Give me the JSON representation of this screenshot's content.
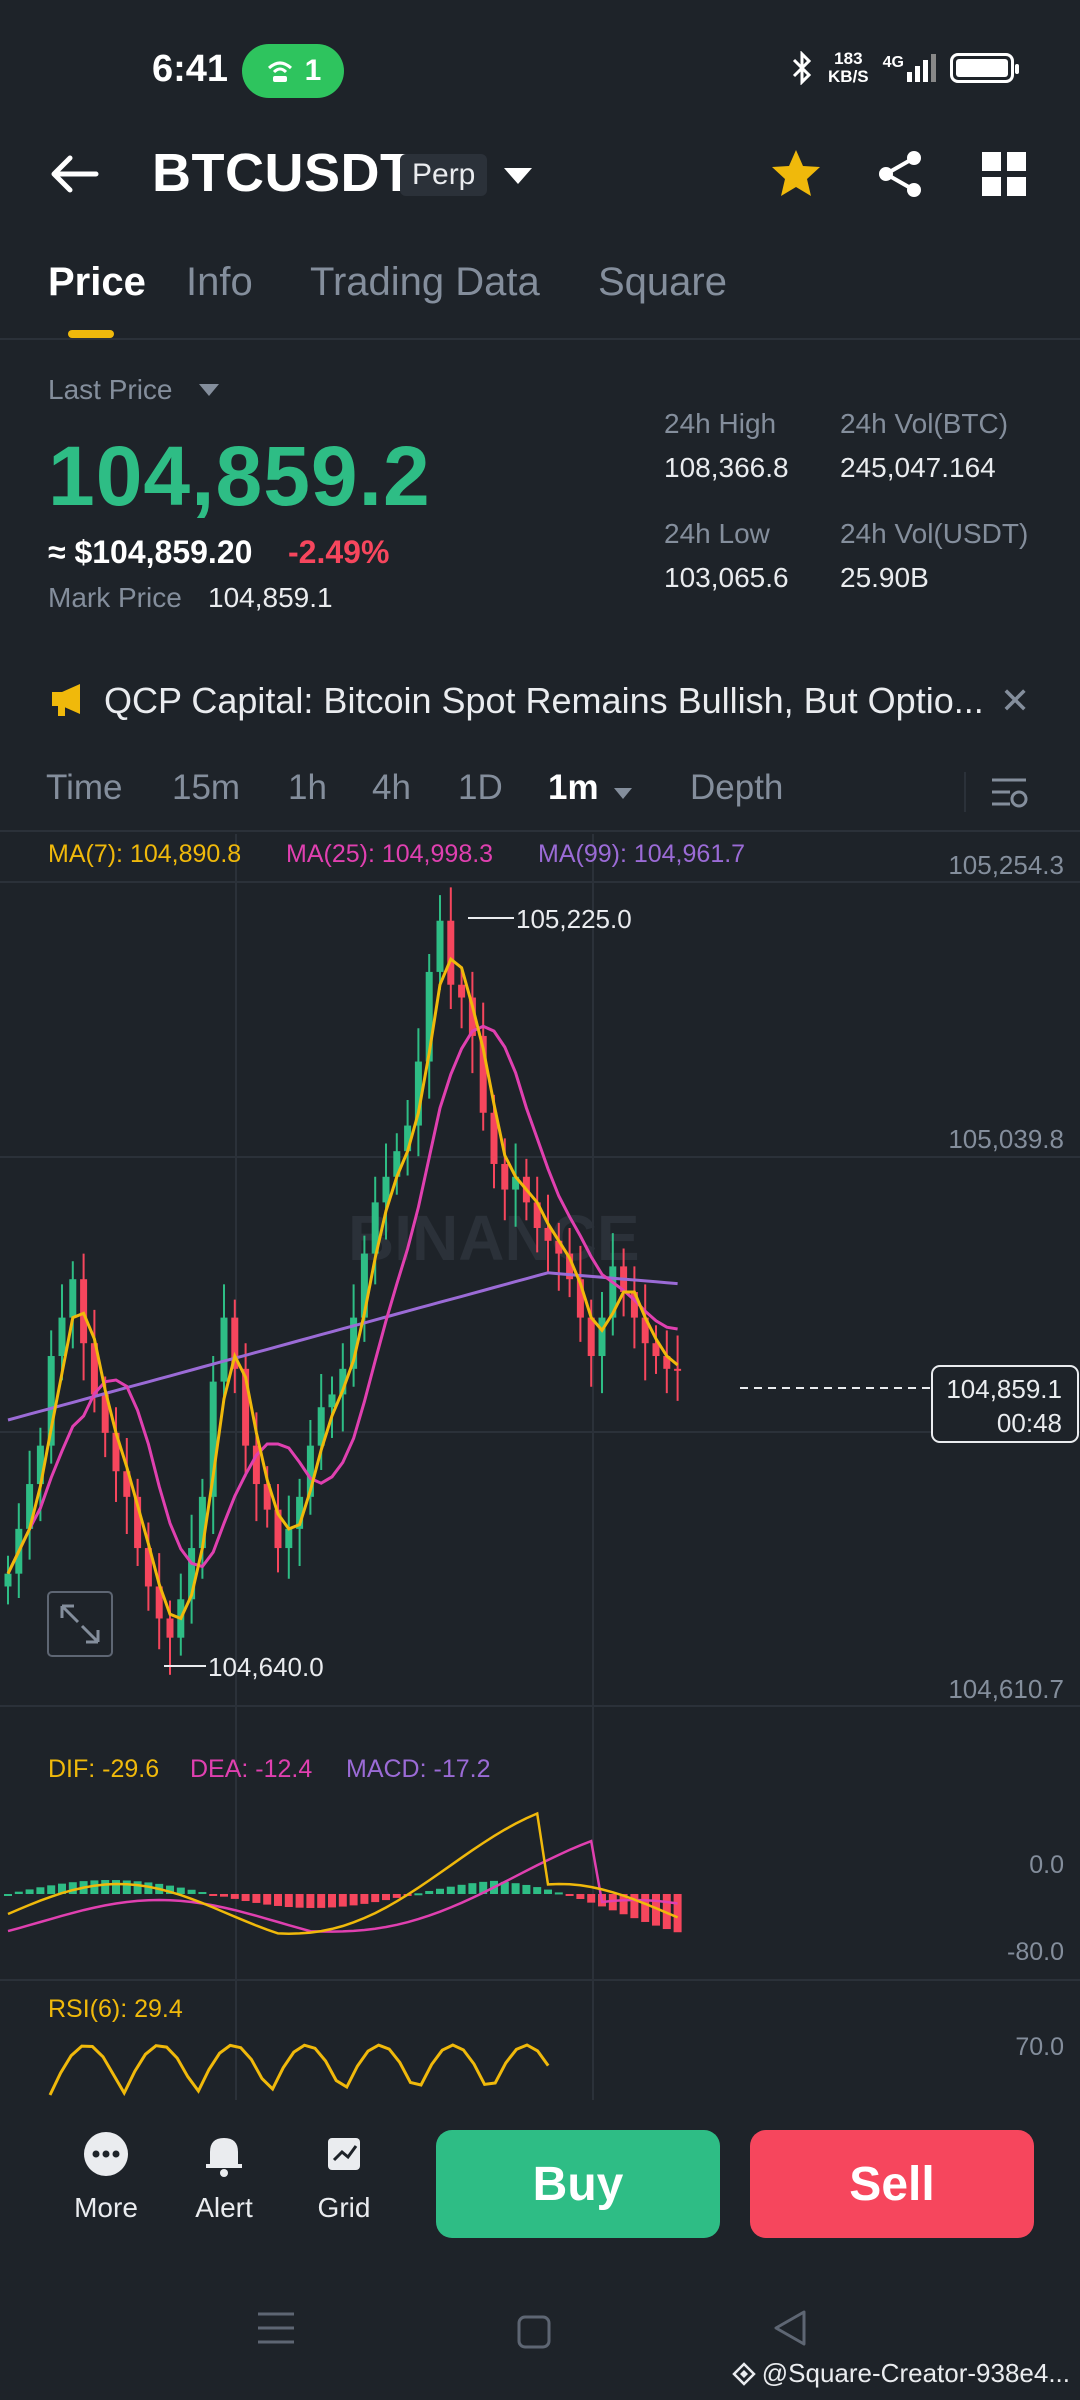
{
  "status_bar": {
    "time": "6:41",
    "hotspot_count": "1",
    "net_speed_value": "183",
    "net_speed_unit": "KB/S",
    "network": "4G"
  },
  "header": {
    "symbol": "BTCUSDT",
    "badge": "Perp"
  },
  "tabs": [
    {
      "label": "Price",
      "active": true
    },
    {
      "label": "Info"
    },
    {
      "label": "Trading Data"
    },
    {
      "label": "Square"
    }
  ],
  "price": {
    "last_price_label": "Last Price",
    "last_price": "104,859.2",
    "usd_price": "≈ $104,859.20",
    "change_pct": "-2.49%",
    "mark_label": "Mark Price",
    "mark_value": "104,859.1"
  },
  "stats": {
    "high_label": "24h High",
    "high_value": "108,366.8",
    "vol_btc_label": "24h Vol(BTC)",
    "vol_btc_value": "245,047.164",
    "low_label": "24h Low",
    "low_value": "103,065.6",
    "vol_usdt_label": "24h Vol(USDT)",
    "vol_usdt_value": "25.90B"
  },
  "news": {
    "text": "QCP Capital: Bitcoin Spot Remains Bullish, But Optio...",
    "close": "✕"
  },
  "intervals": [
    {
      "label": "Time"
    },
    {
      "label": "15m"
    },
    {
      "label": "1h"
    },
    {
      "label": "4h"
    },
    {
      "label": "1D"
    },
    {
      "label": "1m",
      "active": true
    },
    {
      "label": "Depth"
    }
  ],
  "chart": {
    "ma7_label": "MA(7): 104,890.8",
    "ma25_label": "MA(25): 104,998.3",
    "ma99_label": "MA(99): 104,961.7",
    "price_scale": [
      "105,254.3",
      "105,039.8",
      "104,610.7"
    ],
    "high_marker": "105,225.0",
    "low_marker": "104,640.0",
    "current_price": "104,859.1",
    "countdown": "00:48",
    "watermark": "BINANCE",
    "colors": {
      "up": "#2ebd85",
      "down": "#f6465d",
      "ma7": "#f0b90b",
      "ma25": "#e040b0",
      "ma99": "#9b6bd6"
    }
  },
  "macd": {
    "dif_label": "DIF: -29.6",
    "dea_label": "DEA: -12.4",
    "macd_label": "MACD: -17.2",
    "scale_top": "0.0",
    "scale_bottom": "-80.0"
  },
  "rsi": {
    "label": "RSI(6): 29.4",
    "scale": "70.0"
  },
  "bottom_bar": {
    "more": "More",
    "alert": "Alert",
    "grid": "Grid",
    "buy": "Buy",
    "sell": "Sell"
  },
  "watermark_text": "@Square-Creator-938e4..."
}
